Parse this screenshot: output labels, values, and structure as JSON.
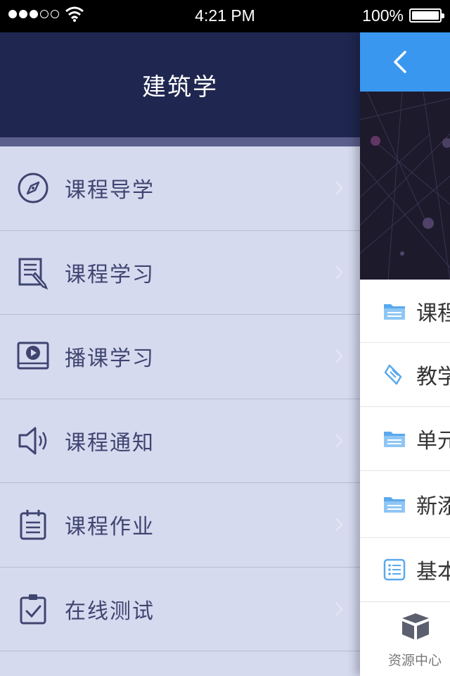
{
  "status_bar": {
    "time": "4:21 PM",
    "battery_percent": "100%",
    "signal_icon": "signal-dots-icon",
    "wifi_icon": "wifi-icon"
  },
  "menu": {
    "title": "建筑学",
    "items": [
      {
        "label": "课程导学",
        "icon": "compass-icon"
      },
      {
        "label": "课程学习",
        "icon": "document-pencil-icon"
      },
      {
        "label": "播课学习",
        "icon": "video-play-icon"
      },
      {
        "label": "课程通知",
        "icon": "speaker-icon"
      },
      {
        "label": "课程作业",
        "icon": "clipboard-list-icon"
      },
      {
        "label": "在线测试",
        "icon": "clipboard-check-icon"
      }
    ]
  },
  "panel": {
    "back_icon": "chevron-left-icon",
    "rows": [
      {
        "label": "课程",
        "icon": "folder-icon"
      },
      {
        "label": "教学",
        "icon": "scroll-icon"
      },
      {
        "label": "单元",
        "icon": "folder-icon"
      },
      {
        "label": "新添",
        "icon": "folder-icon"
      },
      {
        "label": "基本",
        "icon": "list-icon"
      }
    ],
    "tab": {
      "label": "资源中心",
      "icon": "open-box-icon"
    }
  },
  "colors": {
    "menu_header": "#1f2750",
    "menu_bg": "#d6daef",
    "menu_text": "#3f4570",
    "accent_blue": "#3a97f0"
  }
}
